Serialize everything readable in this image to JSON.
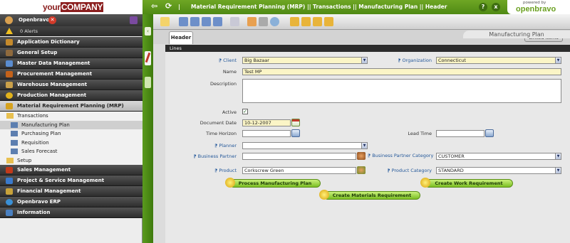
{
  "header": {
    "logo_your": "your",
    "logo_company": "COMPANY",
    "breadcrumb": "Material Requirement Planning (MRP) || Transactions || Manufacturing Plan || Header",
    "powered_by": "powered by",
    "brand": "openbravo",
    "help_label": "?",
    "close_label": "x"
  },
  "sidebar": {
    "user": "Openbravo",
    "alerts": "0 Alerts",
    "menu": [
      {
        "label": "Application Dictionary",
        "color": "#c58a2c"
      },
      {
        "label": "General Setup",
        "color": "#8f6a3d"
      },
      {
        "label": "Master Data Management",
        "color": "#5a8ccf"
      },
      {
        "label": "Procurement Management",
        "color": "#c4621a"
      },
      {
        "label": "Warehouse Management",
        "color": "#caa04a"
      },
      {
        "label": "Production Management",
        "color": "#e1b21c"
      },
      {
        "label": "Material Requirement Planning (MRP)",
        "color": "#d6a21e",
        "open": true
      }
    ],
    "submenu": {
      "transactions": "Transactions",
      "items": [
        "Manufacturing Plan",
        "Purchasing Plan",
        "Requisition",
        "Sales Forecast"
      ],
      "setup": "Setup"
    },
    "menu2": [
      {
        "label": "Sales Management",
        "color": "#c23a1a"
      },
      {
        "label": "Project & Service Management",
        "color": "#3a7acc"
      },
      {
        "label": "Financial Management",
        "color": "#c8a23a"
      },
      {
        "label": "Openbravo ERP",
        "color": "#3a90d6"
      },
      {
        "label": "Information",
        "color": "#4a80c0"
      }
    ]
  },
  "tabs": {
    "header_tab": "Header",
    "linked_items": "Linked Items",
    "title": "Manufacturing Plan",
    "lines": "Lines"
  },
  "form": {
    "client_label": "Client",
    "client_value": "Big Bazaar",
    "organization_label": "Organization",
    "organization_value": "Connecticut",
    "name_label": "Name",
    "name_value": "Test MP",
    "description_label": "Description",
    "description_value": "",
    "active_label": "Active",
    "active_checked": "✓",
    "document_date_label": "Document Date",
    "document_date_value": "10-12-2007",
    "time_horizon_label": "Time Horizon",
    "time_horizon_value": "",
    "lead_time_label": "Lead Time",
    "lead_time_value": "",
    "planner_label": "Planner",
    "planner_value": "",
    "business_partner_label": "Business Partner",
    "business_partner_value": "",
    "bp_category_label": "Business Partner Category",
    "bp_category_value": "CUSTOMER",
    "product_label": "Product",
    "product_value": "Corkscrew  Green",
    "product_category_label": "Product Category",
    "product_category_value": "STANDARD"
  },
  "actions": {
    "process": "Process Manufacturing Plan",
    "work_requirement": "Create Work Requirement",
    "materials_requirement": "Create Materials Requirement"
  },
  "colors": {
    "accent_green": "#5a9a1e",
    "required_label": "#24589a",
    "mandatory_field": "#fbf5c6"
  }
}
